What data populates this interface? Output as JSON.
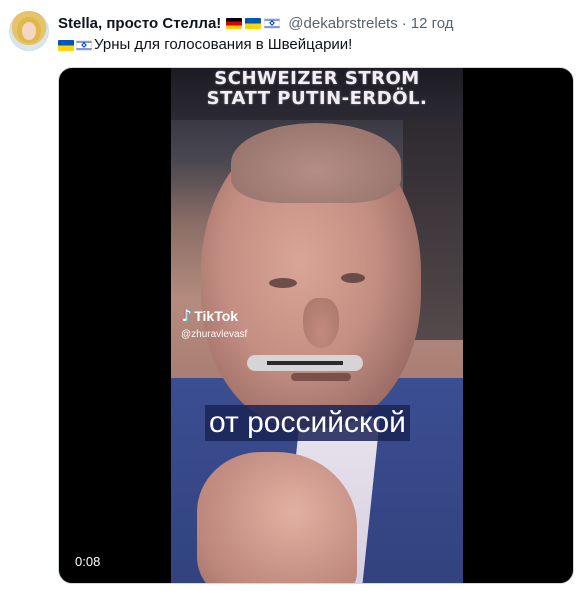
{
  "tweet": {
    "display_name": "Stella, просто Стелла!",
    "name_flags": [
      "germany-flag-icon",
      "ukraine-flag-icon",
      "israel-flag-icon"
    ],
    "handle": "@dekabrstrelets",
    "separator": "·",
    "time": "12 год",
    "text_flags": [
      "ukraine-flag-icon",
      "israel-flag-icon"
    ],
    "text": "Урны для голосования в Швейцарии!"
  },
  "media": {
    "banner_line1": "SCHWEIZER STROM",
    "banner_line2": "STATT PUTIN-ERDÖL.",
    "tiktok_label": "TikTok",
    "tiktok_user": "@zhuravlevasf",
    "caption": "от российской",
    "duration": "0:08"
  },
  "colors": {
    "text_primary": "#0f1419",
    "text_secondary": "#536471",
    "media_background": "#000000",
    "caption_background": "#1a2356"
  }
}
